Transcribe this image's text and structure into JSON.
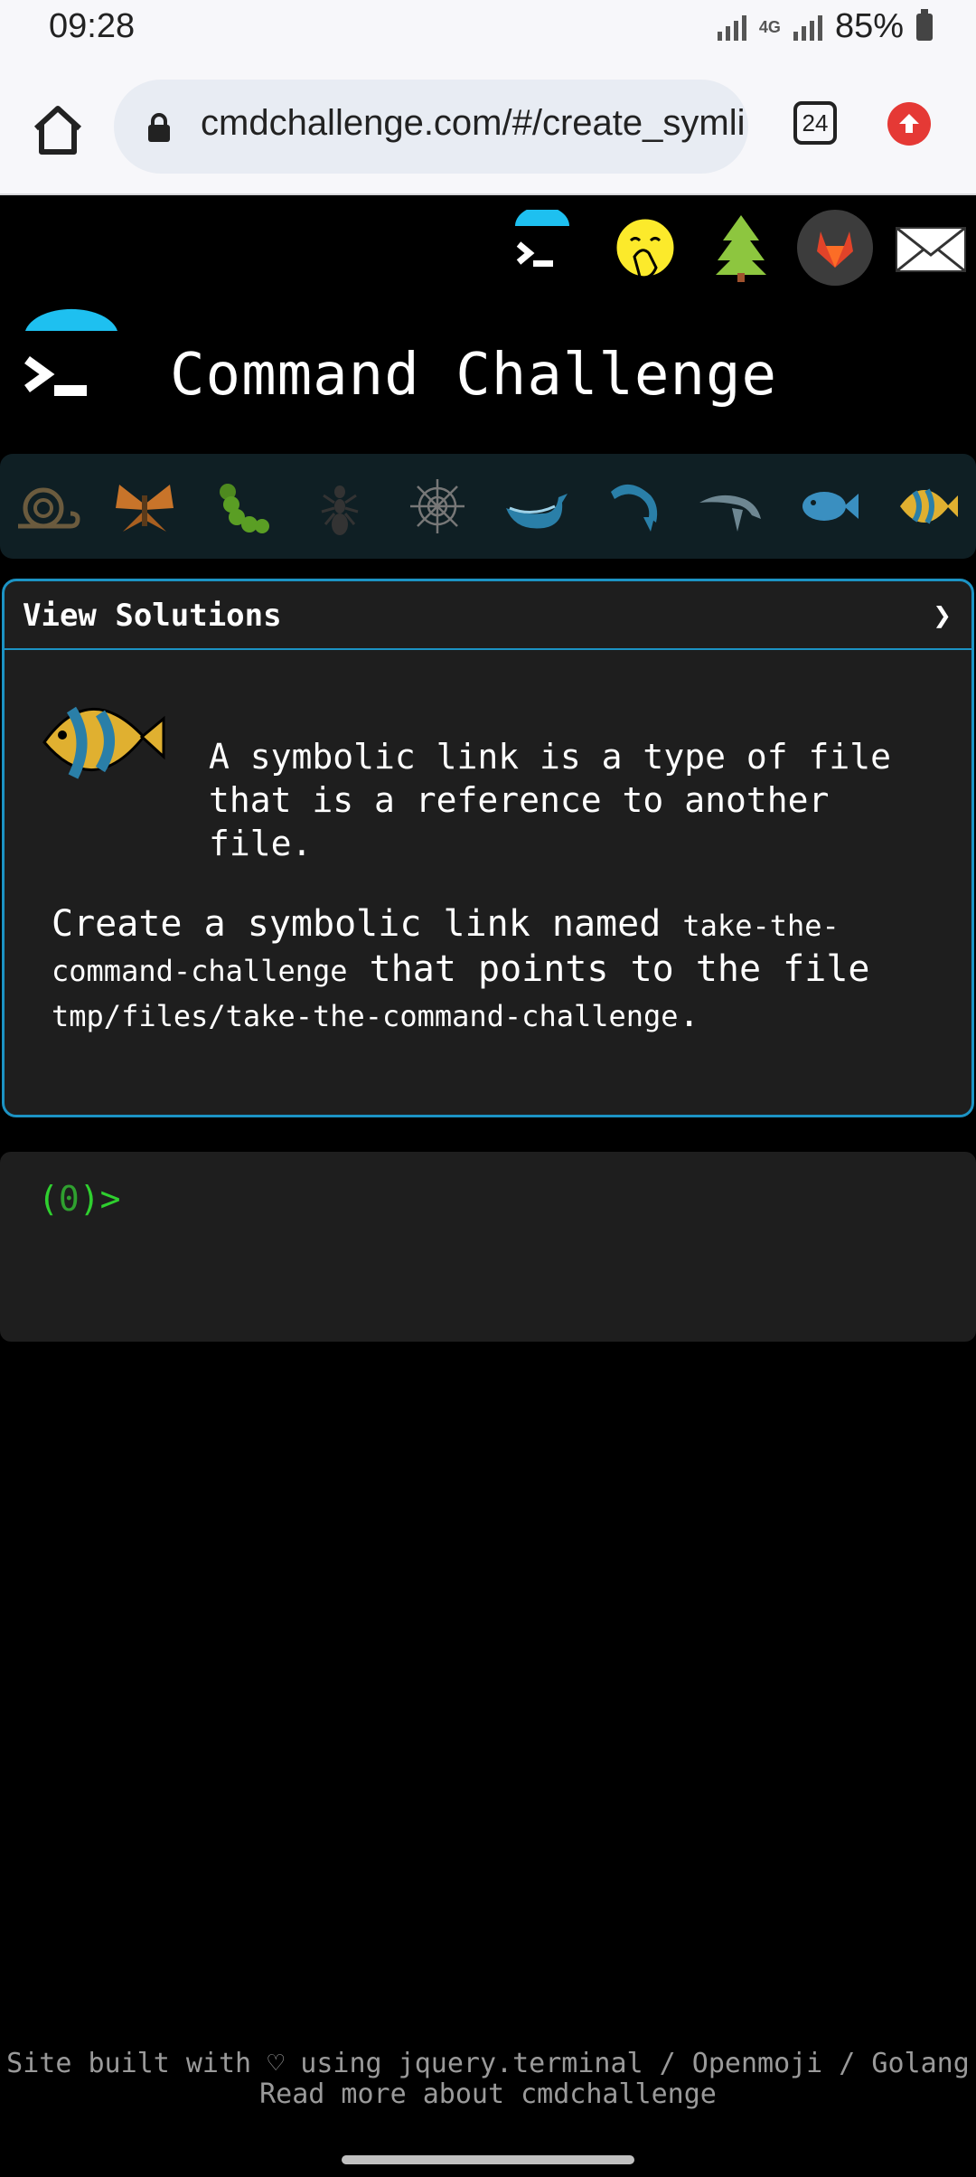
{
  "status": {
    "time": "09:28",
    "network": "4G",
    "battery": "85%"
  },
  "browser": {
    "url": "cmdchallenge.com/#/create_symli",
    "tab_count": "24"
  },
  "header": {
    "title": "Command Challenge"
  },
  "top_icons": [
    "terminal-icon",
    "hand-over-mouth-emoji-icon",
    "tree-icon",
    "gitlab-icon",
    "envelope-icon"
  ],
  "animals": [
    "snail-icon",
    "butterfly-icon",
    "caterpillar-icon",
    "ant-icon",
    "spider-web-icon",
    "whale-icon",
    "dolphin-jump-icon",
    "dolphin-icon",
    "fish-icon",
    "tropical-fish-icon"
  ],
  "card": {
    "solutions_label": "View Solutions",
    "toggle": "❯",
    "intro": "A symbolic link is a type of file that is a reference to another file.",
    "task_prefix": "Create a symbolic link named ",
    "link_name": "take-the-command-challenge",
    "task_middle": " that points to the file ",
    "target_path": "tmp/files/take-the-command-challenge",
    "task_suffix": "."
  },
  "terminal": {
    "prompt_open": "(",
    "prompt_count": "0",
    "prompt_close": ")>"
  },
  "footer": {
    "line1": "Site built with ♡ using jquery.terminal / Openmoji / Golang",
    "line2": "Read more about cmdchallenge"
  },
  "colors": {
    "accent": "#1c93c4",
    "prompt": "#2fd02f",
    "logo_arc": "#1ec0f0"
  }
}
